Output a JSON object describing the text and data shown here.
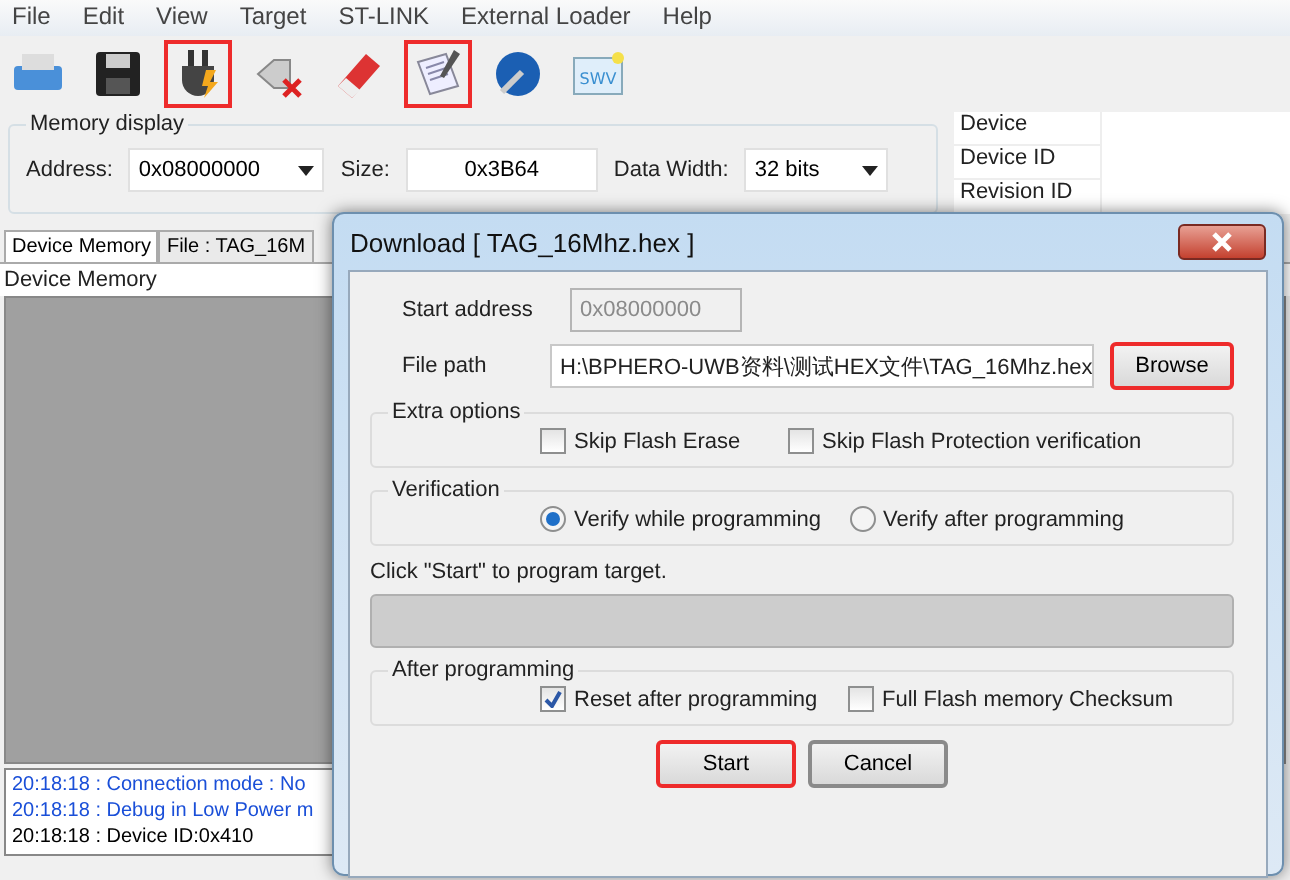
{
  "menu": [
    "File",
    "Edit",
    "View",
    "Target",
    "ST-LINK",
    "External Loader",
    "Help"
  ],
  "toolbar": [
    {
      "kind": "open",
      "highlighted": false
    },
    {
      "kind": "save",
      "highlighted": false
    },
    {
      "kind": "connect",
      "highlighted": true
    },
    {
      "kind": "disconnect",
      "highlighted": false
    },
    {
      "kind": "erase",
      "highlighted": false
    },
    {
      "kind": "program",
      "highlighted": true
    },
    {
      "kind": "settings",
      "highlighted": false
    },
    {
      "kind": "swv",
      "label": "SWV",
      "highlighted": false
    }
  ],
  "memory_display": {
    "title": "Memory display",
    "address_label": "Address:",
    "address": "0x08000000",
    "size_label": "Size:",
    "size": "0x3B64",
    "width_label": "Data Width:",
    "width": "32 bits"
  },
  "device_info": [
    "Device",
    "Device ID",
    "Revision ID"
  ],
  "tabs": [
    {
      "label": "Device Memory",
      "selected": true
    },
    {
      "label": "File : TAG_16M",
      "selected": false
    }
  ],
  "memory_header": "Device Memory",
  "log": [
    {
      "text": "20:18:18 : Connection mode : No",
      "color": "#1a4fd8"
    },
    {
      "text": "20:18:18 : Debug in Low Power m",
      "color": "#1a4fd8"
    },
    {
      "text": "20:18:18 : Device ID:0x410",
      "color": "#000000"
    }
  ],
  "dialog": {
    "title": "Download [ TAG_16Mhz.hex ]",
    "start_address_label": "Start address",
    "start_address": "0x08000000",
    "file_path_label": "File path",
    "file_path": "H:\\BPHERO-UWB资料\\测试HEX文件\\TAG_16Mhz.hex",
    "browse": {
      "label": "Browse",
      "highlighted": true
    },
    "extra_options": {
      "title": "Extra options",
      "items": [
        {
          "label": "Skip Flash Erase",
          "checked": false
        },
        {
          "label": "Skip Flash Protection verification",
          "checked": false
        }
      ]
    },
    "verification": {
      "title": "Verification",
      "items": [
        {
          "label": "Verify while programming",
          "selected": true
        },
        {
          "label": "Verify after programming",
          "selected": false
        }
      ]
    },
    "hint": "Click \"Start\" to program target.",
    "progress": {
      "level": 0
    },
    "after_programming": {
      "title": "After programming",
      "items": [
        {
          "label": "Reset after programming",
          "checked": true
        },
        {
          "label": "Full Flash memory Checksum",
          "checked": false
        }
      ]
    },
    "buttons": [
      {
        "label": "Start",
        "highlighted": true
      },
      {
        "label": "Cancel",
        "highlighted": false
      }
    ]
  }
}
